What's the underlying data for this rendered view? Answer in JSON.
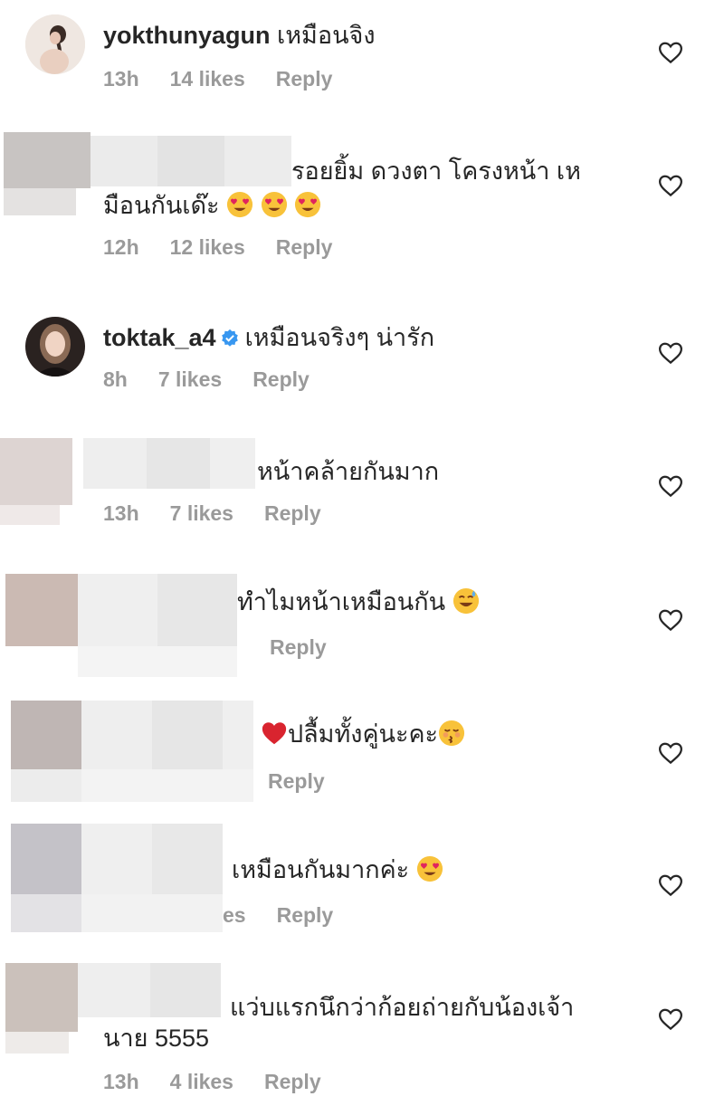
{
  "comments": [
    {
      "username": "yokthunyagun",
      "text": "เหมือนจิง",
      "time": "13h",
      "likes": "14 likes",
      "reply": "Reply"
    },
    {
      "line1": "รอยยิ้ม ดวงตา โครงหน้า เห",
      "line2": "มือนกันเด๊ะ",
      "time": "12h",
      "likes": "12 likes",
      "reply": "Reply"
    },
    {
      "username": "toktak_a4",
      "text": "เหมือนจริงๆ น่ารัก",
      "time": "8h",
      "likes": "7 likes",
      "reply": "Reply"
    },
    {
      "text": "หน้าคล้ายกันมาก",
      "time": "13h",
      "likes": "7 likes",
      "reply": "Reply"
    },
    {
      "text": "ทำไมหน้าเหมือนกัน",
      "reply": "Reply"
    },
    {
      "text": "ปลื้มทั้งคู่นะคะ",
      "reply": "Reply"
    },
    {
      "text": "เหมือนกันมากค่ะ",
      "likes_partial": "es",
      "reply": "Reply"
    },
    {
      "line1": "แว่บแรกนึกว่าก้อยถ่ายกับน้องเจ้า",
      "line2": "นาย 5555",
      "time": "13h",
      "likes": "4 likes",
      "reply": "Reply"
    }
  ],
  "icons": {
    "like": "heart-outline-icon",
    "verified": "verified-badge-icon",
    "emoji_heart_eyes": "heart-eyes-emoji",
    "emoji_sweat_smile": "sweat-smile-emoji",
    "emoji_red_heart": "red-heart-emoji",
    "emoji_kissing": "kissing-closed-eyes-emoji"
  },
  "colors": {
    "meta_text": "#9a9a9a",
    "text": "#262626",
    "verified": "#3897f0",
    "heart_outline": "#262626"
  }
}
